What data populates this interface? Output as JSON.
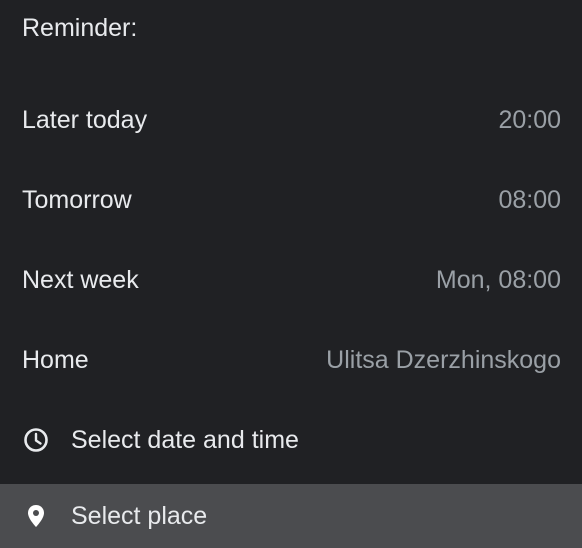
{
  "reminder_menu": {
    "header": "Reminder:",
    "items": [
      {
        "label": "Later today",
        "value": "20:00"
      },
      {
        "label": "Tomorrow",
        "value": "08:00"
      },
      {
        "label": "Next week",
        "value": "Mon, 08:00"
      },
      {
        "label": "Home",
        "value": "Ulitsa Dzerzhinskogo"
      }
    ],
    "select_date_time": {
      "label": "Select date and time",
      "icon": "clock-icon"
    },
    "select_place": {
      "label": "Select place",
      "icon": "location-pin-icon"
    }
  },
  "colors": {
    "background": "#202124",
    "text": "#e8eaed",
    "secondary_text": "#9aa0a6",
    "highlight": "#4b4c4f"
  }
}
